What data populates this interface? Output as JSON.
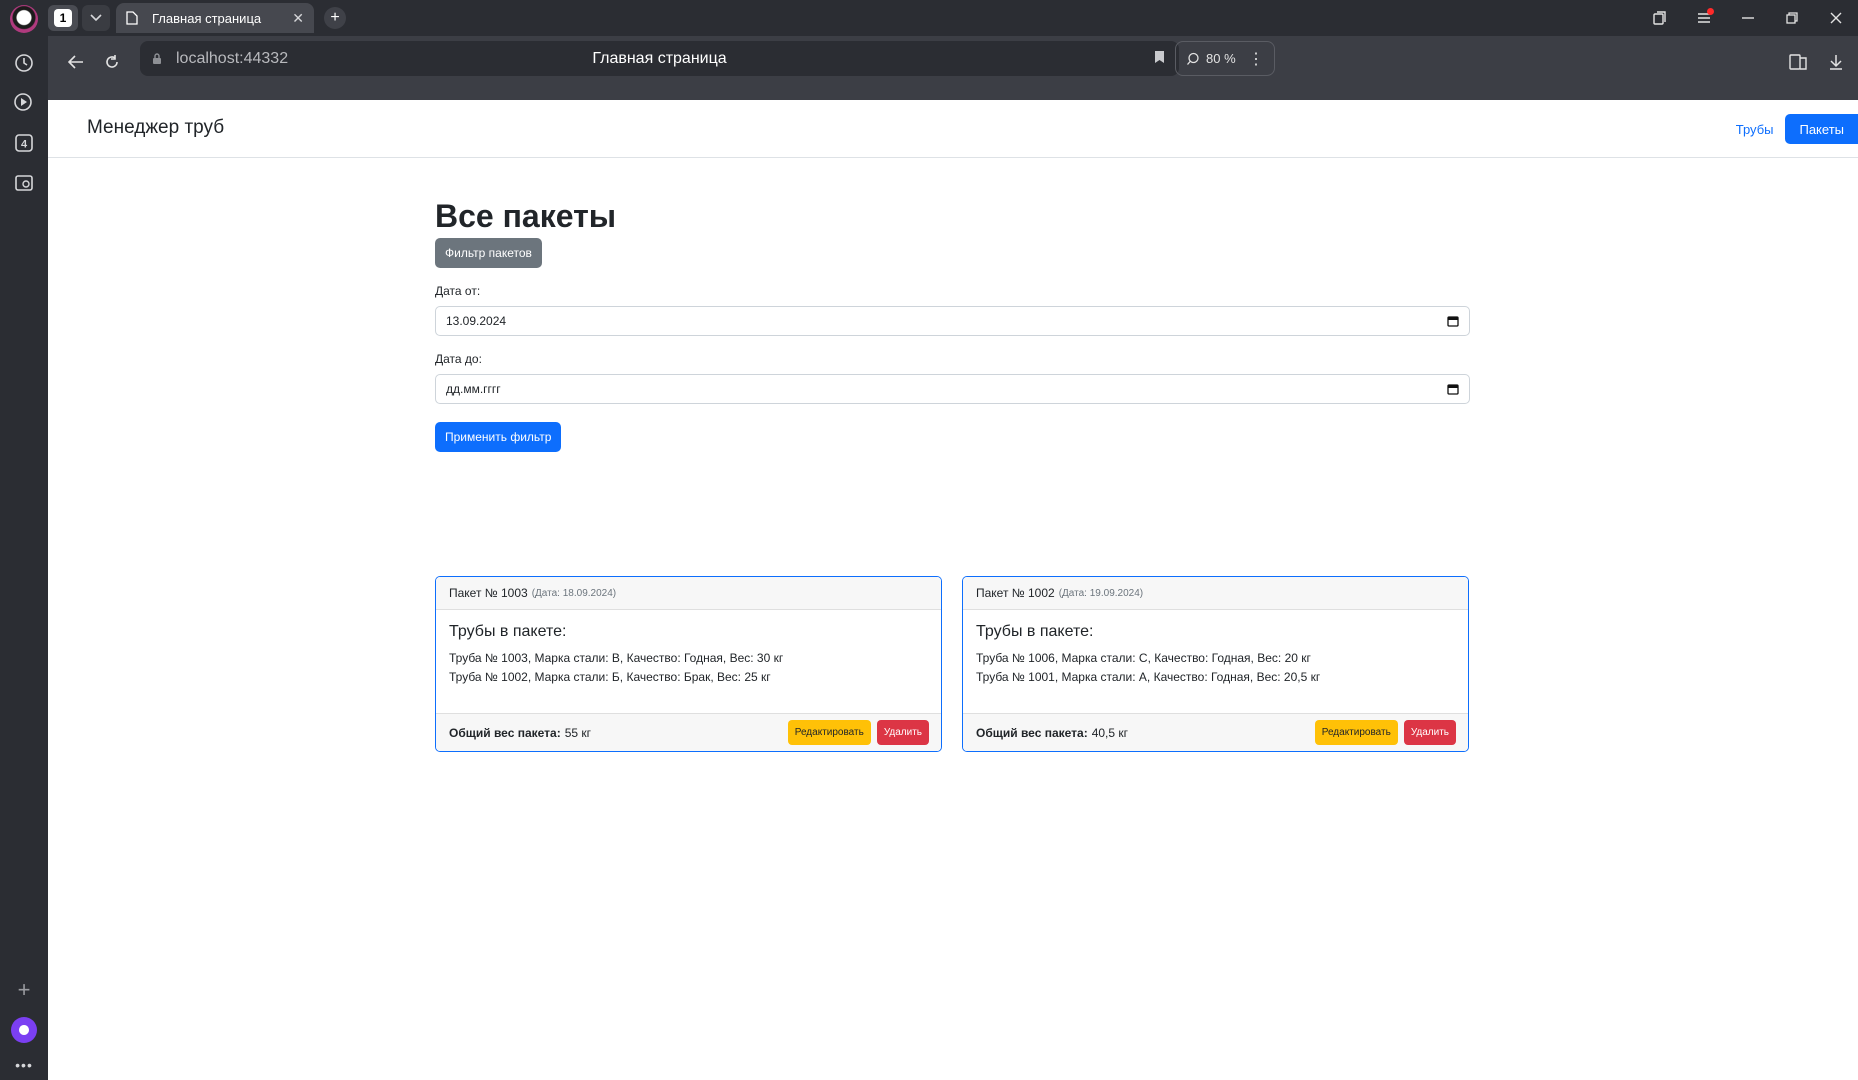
{
  "browser": {
    "tab_count": "1",
    "tab_title": "Главная страница",
    "url": "localhost:44332",
    "page_title": "Главная страница",
    "zoom": "80 %",
    "sidebar_badge": "4"
  },
  "navbar": {
    "brand": "Менеджер труб",
    "link_pipes": "Трубы",
    "link_packages": "Пакеты"
  },
  "main": {
    "title": "Все пакеты",
    "filter_button": "Фильтр пакетов",
    "date_from_label": "Дата от:",
    "date_from_value": "13.09.2024",
    "date_to_label": "Дата до:",
    "date_to_value": "дд.мм.гггг",
    "apply_button": "Применить фильтр"
  },
  "packages": [
    {
      "header": "Пакет № 1003",
      "date": "(Дата: 18.09.2024)",
      "pipes_title": "Трубы в пакете:",
      "pipes": [
        "Труба № 1003, Марка стали: B, Качество: Годная, Вес: 30 кг",
        "Труба № 1002, Марка стали: Б, Качество: Брак, Вес: 25 кг"
      ],
      "total_label": "Общий вес пакета:",
      "total_value": "55 кг",
      "edit_button": "Редактировать",
      "delete_button": "Удалить"
    },
    {
      "header": "Пакет № 1002",
      "date": "(Дата: 19.09.2024)",
      "pipes_title": "Трубы в пакете:",
      "pipes": [
        "Труба № 1006, Марка стали: С, Качество: Годная, Вес: 20 кг",
        "Труба № 1001, Марка стали: А, Качество: Годная, Вес: 20,5 кг"
      ],
      "total_label": "Общий вес пакета:",
      "total_value": "40,5 кг",
      "edit_button": "Редактировать",
      "delete_button": "Удалить"
    }
  ],
  "colors": {
    "primary": "#0d6efd",
    "secondary": "#6c757d",
    "warning": "#ffc107",
    "danger": "#dc3545"
  }
}
